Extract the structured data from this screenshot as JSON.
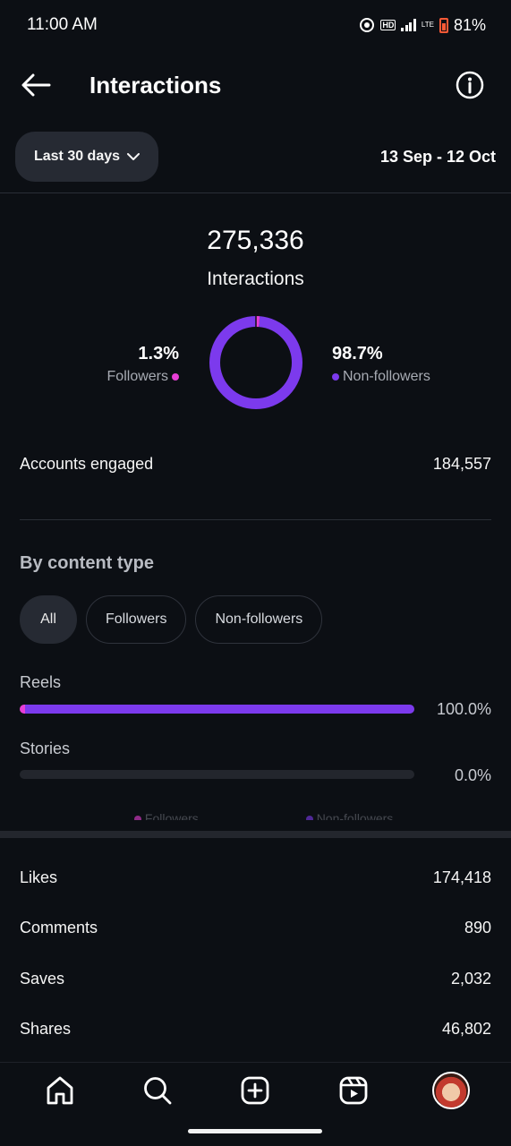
{
  "status_bar": {
    "time": "11:00 AM",
    "battery": "81%",
    "hd": "HD",
    "lte": "LTE"
  },
  "header": {
    "title": "Interactions"
  },
  "filter": {
    "range_label": "Last 30 days",
    "date_range": "13 Sep - 12 Oct"
  },
  "summary": {
    "total": "275,336",
    "total_label": "Interactions",
    "followers_pct": "1.3%",
    "followers_label": "Followers",
    "followers_fraction": 0.013,
    "non_followers_pct": "98.7%",
    "non_followers_label": "Non-followers",
    "non_followers_fraction": 0.987
  },
  "accounts_engaged": {
    "label": "Accounts engaged",
    "value": "184,557"
  },
  "content_type": {
    "title": "By content type",
    "tabs": [
      "All",
      "Followers",
      "Non-followers"
    ],
    "active_tab": "All",
    "items": [
      {
        "label": "Reels",
        "pct": "100.0%",
        "follower_fraction": 0.013,
        "non_follower_fraction": 0.987
      },
      {
        "label": "Stories",
        "pct": "0.0%",
        "follower_fraction": 0,
        "non_follower_fraction": 0
      }
    ]
  },
  "metrics": [
    {
      "label": "Likes",
      "value": "174,418"
    },
    {
      "label": "Comments",
      "value": "890"
    },
    {
      "label": "Saves",
      "value": "2,032"
    },
    {
      "label": "Shares",
      "value": "46,802"
    }
  ],
  "nav": [
    "home-icon",
    "search-icon",
    "create-icon",
    "reels-icon",
    "profile-avatar"
  ],
  "colors": {
    "followers": "#e83ed6",
    "non_followers": "#7c3aed",
    "background": "#0c0f14"
  }
}
